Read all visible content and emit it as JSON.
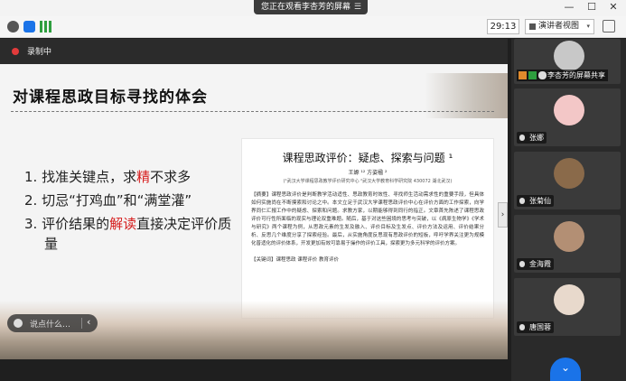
{
  "window": {
    "share_notice": "您正在观看李杏芳的屏幕",
    "share_menu_icon": "menu-icon",
    "min_glyph": "—",
    "max_glyph": "☐",
    "close_glyph": "✕"
  },
  "toolbar": {
    "timer": "29:13",
    "view_mode": "演讲者视图",
    "view_dropdown_glyph": "▾",
    "icon_colors": {
      "info": "#555555",
      "shield": "#1a73e8",
      "signal": "#2e9e3e"
    }
  },
  "recording": {
    "label": "录制中"
  },
  "slide": {
    "title": "对课程思政目标寻找的体会",
    "bullets": [
      {
        "num": "1.",
        "before": "找准关键点，求",
        "highlight": "精",
        "after": "不求多"
      },
      {
        "num": "2.",
        "before": "切忌“打鸡血”和“满堂灌”",
        "highlight": "",
        "after": ""
      },
      {
        "num": "3.",
        "before": "评价结果的",
        "highlight": "解读",
        "after": "直接决定评价质量"
      }
    ],
    "paper": {
      "title": "课程思政评价：疑虑、探索与问题 ¹",
      "authors": "王嫄 ¹² 方姿楹 ²",
      "affiliation": "(¹武汉大学课程思政教学评价研究中心 ²武汉大学教育科学研究院 430072 湖北武汉)",
      "abstract": "【摘要】课程思政评价是判断教学活动适性、思政教育时效性、寻找师生活动需求性的重要手段，但具体如何实施尚在不断摸索和讨论之中。本文立足于武汉大学课程思政评价中心在评价方面的工作探索，向学界同仁汇报工作中的疑虑、探索和问题。求教方家，以期能够得到同行的指正。文章首先陈述了课程思政评价可行性所面临的现实与理论双重难题。随后，基于对这些困境的思考与突破，以《病原生物学》《学术与研究》两个课程为例，从思政元素的生发及融入、评价目标及生发点、评价方法及运用、评价结果分析、反思几个维度分享了探索经验。最后，从实施角度反思现有思政评价的短板，呼吁学界关注更为规模化普适化的评价体系，开发更加有效可靠易于操作的评价工具，探索更为多元科学的评价方案。",
      "keywords": "【关键词】课程思政 课程评价 教育评价"
    },
    "accent_color": "#d61b1b"
  },
  "chat": {
    "placeholder": "说点什么…",
    "chevron": "‹"
  },
  "panel": {
    "collapse_glyph": "›",
    "scroll_glyph": "⌄",
    "tiles": [
      {
        "name": "李杏芳的屏幕共享",
        "avatar_color": "#c8c8c8"
      },
      {
        "name": "张娜",
        "avatar_color": "#f3c7c7"
      },
      {
        "name": "张菊仙",
        "avatar_color": "#8a6a4a"
      },
      {
        "name": "金海霞",
        "avatar_color": "#b38f74"
      },
      {
        "name": "唐国蓉",
        "avatar_color": "#e8d9cc"
      }
    ]
  }
}
